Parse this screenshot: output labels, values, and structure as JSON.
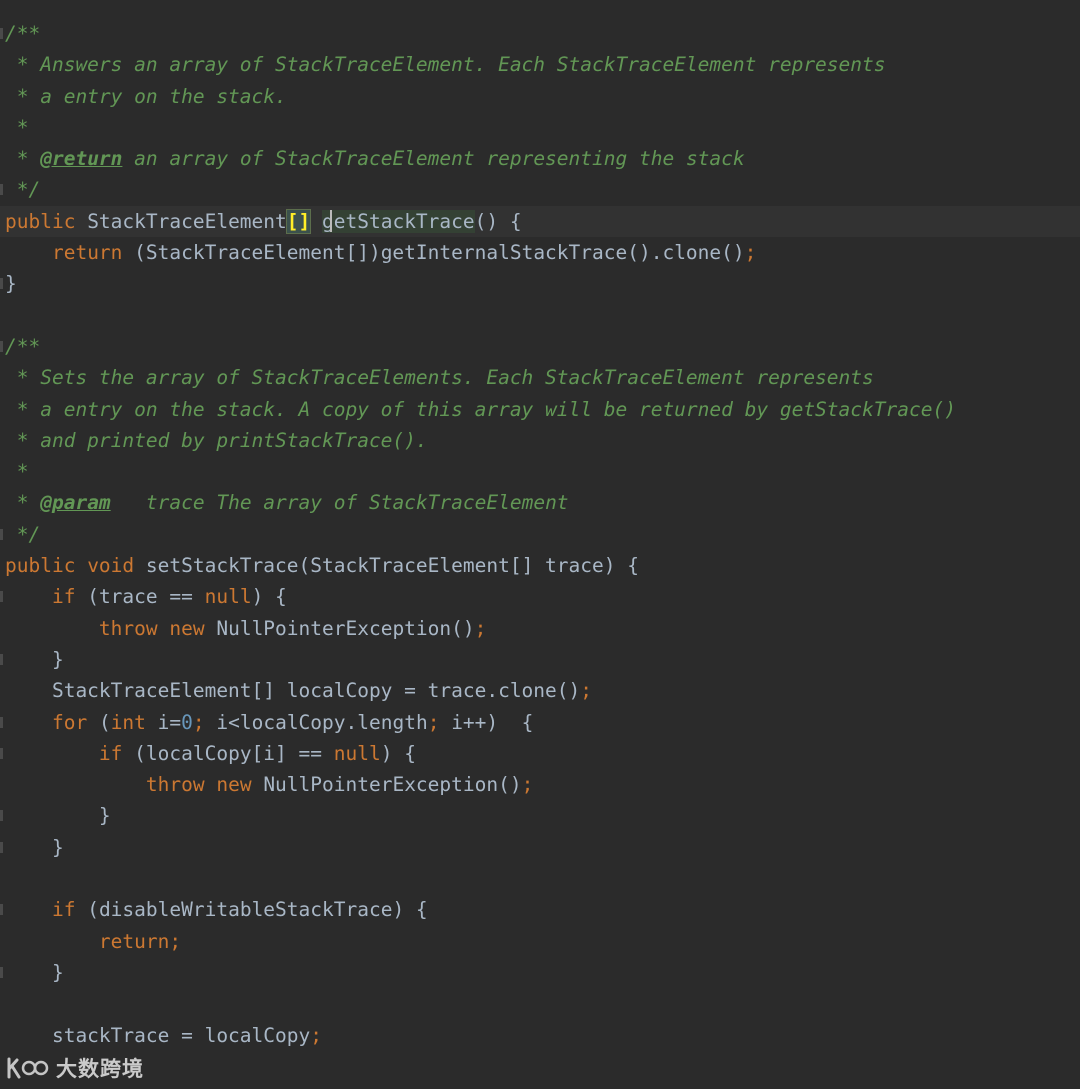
{
  "editor": {
    "lines": [
      {
        "gutter": true,
        "tokens": [
          {
            "t": "/**",
            "c": "cm"
          }
        ]
      },
      {
        "gutter": false,
        "tokens": [
          {
            "t": " * Answers an array of StackTraceElement. Each StackTraceElement represents",
            "c": "cm"
          }
        ]
      },
      {
        "gutter": false,
        "tokens": [
          {
            "t": " * a entry on the stack.",
            "c": "cm"
          }
        ]
      },
      {
        "gutter": false,
        "tokens": [
          {
            "t": " *",
            "c": "cm"
          }
        ]
      },
      {
        "gutter": false,
        "tokens": [
          {
            "t": " * ",
            "c": "cm"
          },
          {
            "t": "@return",
            "c": "tag"
          },
          {
            "t": " an array of StackTraceElement representing the stack",
            "c": "cm"
          }
        ]
      },
      {
        "gutter": true,
        "tokens": [
          {
            "t": " */",
            "c": "cm"
          }
        ]
      },
      {
        "gutter": false,
        "current": true,
        "caret_after_token": 3,
        "tokens": [
          {
            "t": "public ",
            "c": "kw"
          },
          {
            "t": "StackTraceElement",
            "c": "plain"
          },
          {
            "t": "[]",
            "c": "brace-hl"
          },
          {
            "t": " ",
            "c": "plain"
          },
          {
            "t": "getStackTrace",
            "c": "usage-hl"
          },
          {
            "t": "() {",
            "c": "plain"
          }
        ]
      },
      {
        "gutter": false,
        "tokens": [
          {
            "t": "    ",
            "c": "plain"
          },
          {
            "t": "return ",
            "c": "kw"
          },
          {
            "t": "(StackTraceElement[])getInternalStackTrace().clone()",
            "c": "plain"
          },
          {
            "t": ";",
            "c": "punct"
          }
        ]
      },
      {
        "gutter": true,
        "tokens": [
          {
            "t": "}",
            "c": "plain"
          }
        ]
      },
      {
        "gutter": false,
        "tokens": []
      },
      {
        "gutter": true,
        "tokens": [
          {
            "t": "/**",
            "c": "cm"
          }
        ]
      },
      {
        "gutter": false,
        "tokens": [
          {
            "t": " * Sets the array of StackTraceElements. Each StackTraceElement represents",
            "c": "cm"
          }
        ]
      },
      {
        "gutter": false,
        "tokens": [
          {
            "t": " * a entry on the stack. A copy of this array will be returned by getStackTrace()",
            "c": "cm"
          }
        ]
      },
      {
        "gutter": false,
        "tokens": [
          {
            "t": " * and printed by printStackTrace().",
            "c": "cm"
          }
        ]
      },
      {
        "gutter": false,
        "tokens": [
          {
            "t": " *",
            "c": "cm"
          }
        ]
      },
      {
        "gutter": false,
        "tokens": [
          {
            "t": " * ",
            "c": "cm"
          },
          {
            "t": "@param",
            "c": "tag"
          },
          {
            "t": "   trace The array of StackTraceElement",
            "c": "cm"
          }
        ]
      },
      {
        "gutter": true,
        "tokens": [
          {
            "t": " */",
            "c": "cm"
          }
        ]
      },
      {
        "gutter": false,
        "tokens": [
          {
            "t": "public ",
            "c": "kw"
          },
          {
            "t": "void ",
            "c": "kw"
          },
          {
            "t": "setStackTrace(StackTraceElement[] trace) {",
            "c": "plain"
          }
        ]
      },
      {
        "gutter": true,
        "tokens": [
          {
            "t": "    ",
            "c": "plain"
          },
          {
            "t": "if ",
            "c": "kw"
          },
          {
            "t": "(trace == ",
            "c": "plain"
          },
          {
            "t": "null",
            "c": "kw"
          },
          {
            "t": ") {",
            "c": "plain"
          }
        ]
      },
      {
        "gutter": false,
        "tokens": [
          {
            "t": "        ",
            "c": "plain"
          },
          {
            "t": "throw ",
            "c": "kw"
          },
          {
            "t": "new ",
            "c": "kw"
          },
          {
            "t": "NullPointerException()",
            "c": "plain"
          },
          {
            "t": ";",
            "c": "punct"
          }
        ]
      },
      {
        "gutter": true,
        "tokens": [
          {
            "t": "    }",
            "c": "plain"
          }
        ]
      },
      {
        "gutter": false,
        "tokens": [
          {
            "t": "    StackTraceElement[] localCopy = trace.clone()",
            "c": "plain"
          },
          {
            "t": ";",
            "c": "punct"
          }
        ]
      },
      {
        "gutter": true,
        "tokens": [
          {
            "t": "    ",
            "c": "plain"
          },
          {
            "t": "for ",
            "c": "kw"
          },
          {
            "t": "(",
            "c": "plain"
          },
          {
            "t": "int ",
            "c": "kw"
          },
          {
            "t": "i=",
            "c": "plain"
          },
          {
            "t": "0",
            "c": "num"
          },
          {
            "t": "; ",
            "c": "punct"
          },
          {
            "t": "i<localCopy.length",
            "c": "plain"
          },
          {
            "t": "; ",
            "c": "punct"
          },
          {
            "t": "i++)  {",
            "c": "plain"
          }
        ]
      },
      {
        "gutter": true,
        "tokens": [
          {
            "t": "        ",
            "c": "plain"
          },
          {
            "t": "if ",
            "c": "kw"
          },
          {
            "t": "(localCopy[i] == ",
            "c": "plain"
          },
          {
            "t": "null",
            "c": "kw"
          },
          {
            "t": ") {",
            "c": "plain"
          }
        ]
      },
      {
        "gutter": false,
        "tokens": [
          {
            "t": "            ",
            "c": "plain"
          },
          {
            "t": "throw ",
            "c": "kw"
          },
          {
            "t": "new ",
            "c": "kw"
          },
          {
            "t": "NullPointerException()",
            "c": "plain"
          },
          {
            "t": ";",
            "c": "punct"
          }
        ]
      },
      {
        "gutter": true,
        "tokens": [
          {
            "t": "        }",
            "c": "plain"
          }
        ]
      },
      {
        "gutter": true,
        "tokens": [
          {
            "t": "    }",
            "c": "plain"
          }
        ]
      },
      {
        "gutter": false,
        "tokens": []
      },
      {
        "gutter": true,
        "tokens": [
          {
            "t": "    ",
            "c": "plain"
          },
          {
            "t": "if ",
            "c": "kw"
          },
          {
            "t": "(disableWritableStackTrace) {",
            "c": "plain"
          }
        ]
      },
      {
        "gutter": false,
        "tokens": [
          {
            "t": "        ",
            "c": "plain"
          },
          {
            "t": "return",
            "c": "kw"
          },
          {
            "t": ";",
            "c": "punct"
          }
        ]
      },
      {
        "gutter": true,
        "tokens": [
          {
            "t": "    }",
            "c": "plain"
          }
        ]
      },
      {
        "gutter": false,
        "tokens": []
      },
      {
        "gutter": false,
        "tokens": [
          {
            "t": "    stackTrace = localCopy",
            "c": "plain"
          },
          {
            "t": ";",
            "c": "punct"
          }
        ]
      }
    ]
  },
  "watermark": {
    "text": "大数跨境",
    "icon": "kuajing-logo-icon"
  }
}
